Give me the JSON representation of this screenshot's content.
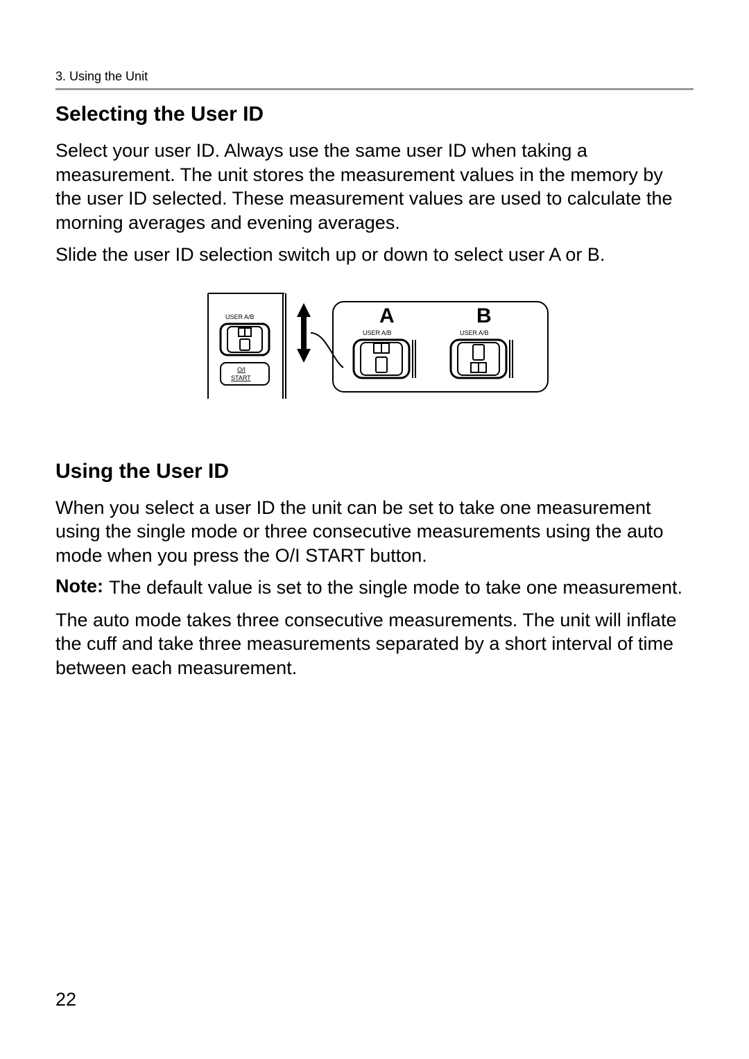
{
  "chapter": "3. Using the Unit",
  "section1": {
    "heading": "Selecting the User ID",
    "p1": "Select your user ID. Always use the same user ID when taking a measurement. The unit stores the measurement values in the memory by the user ID selected. These measurement values are used to calculate the morning averages and evening averages.",
    "p2": "Slide the user ID selection switch up or down to select user A or B."
  },
  "figure": {
    "label_user": "USER A/B",
    "label_start1": "O/I",
    "label_start2": "START",
    "letter_a": "A",
    "letter_b": "B"
  },
  "section2": {
    "heading": "Using the User ID",
    "p1": "When you select a user ID the unit can be set to take one measurement using the single mode or three consecutive measurements using the auto mode when you press the O/I START button.",
    "note_label": "Note:",
    "note_body": "The default value is set to the single mode to take one measurement.",
    "p2": "The auto mode takes three consecutive measurements. The unit will inflate the cuff and take three measurements separated by a short interval of time between each measurement."
  },
  "page_number": "22"
}
